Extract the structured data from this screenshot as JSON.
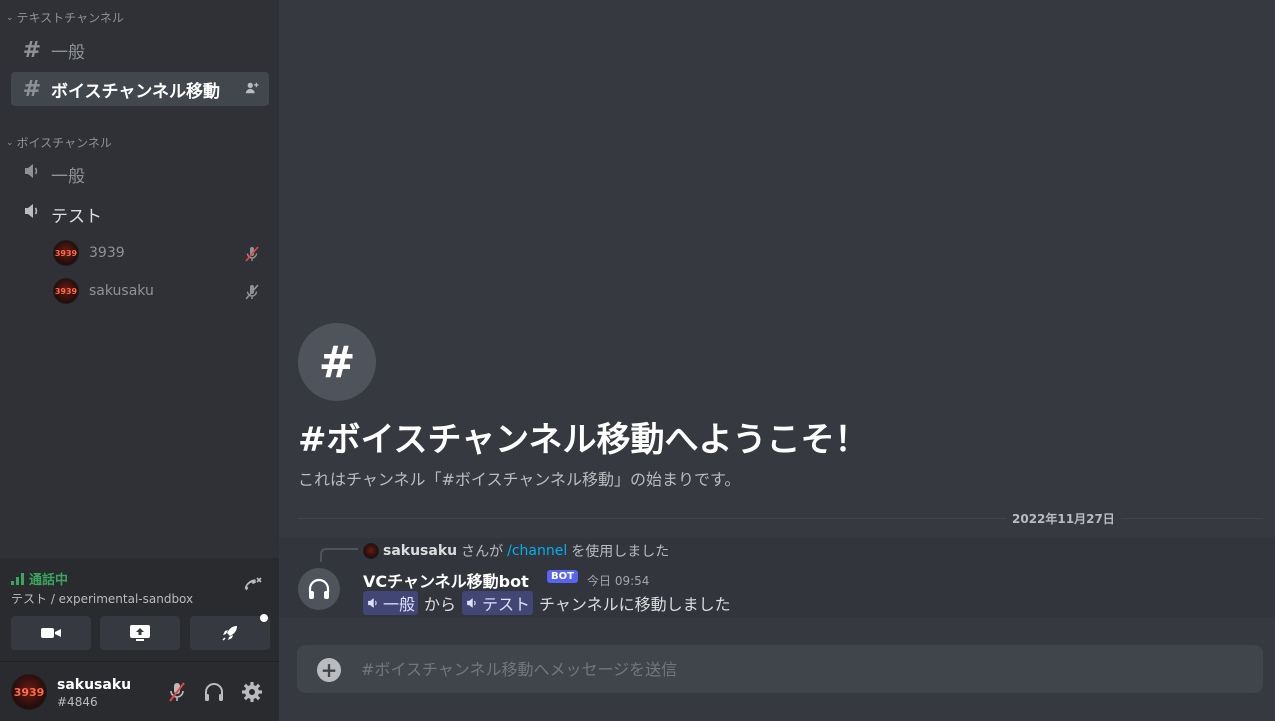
{
  "sidebar": {
    "text_category": "テキストチャンネル",
    "text_channels": [
      {
        "label": "一般"
      },
      {
        "label": "ボイスチャンネル移動"
      }
    ],
    "voice_category": "ボイスチャンネル",
    "voice_channels": [
      {
        "label": "一般"
      },
      {
        "label": "テスト"
      }
    ],
    "voice_users": [
      {
        "name": "3939",
        "avatar_text": "3939"
      },
      {
        "name": "sakusaku",
        "avatar_text": "3939"
      }
    ]
  },
  "voice_panel": {
    "status": "通話中",
    "subtitle": "テスト / experimental-sandbox"
  },
  "user_panel": {
    "username": "sakusaku",
    "tag": "#4846",
    "avatar_text": "3939"
  },
  "welcome": {
    "icon": "#",
    "title": "#ボイスチャンネル移動へようこそ！",
    "description": "これはチャンネル「#ボイスチャンネル移動」の始まりです。"
  },
  "date_divider": "2022年11月27日",
  "message": {
    "reply_user": "sakusaku",
    "reply_mid": "さんが",
    "reply_command": "/channel",
    "reply_end": "を使用しました",
    "author": "VCチャンネル移動bot",
    "bot_tag": "BOT",
    "time": "今日 09:54",
    "from_channel": "一般",
    "text_from": "から",
    "to_channel": "テスト",
    "text_end": "チャンネルに移動しました"
  },
  "composer": {
    "placeholder": "#ボイスチャンネル移動へメッセージを送信"
  },
  "colors": {
    "background": "#36393f",
    "sidebar": "#2f3136",
    "panel": "#292b2f",
    "connected_green": "#3ba55d",
    "blurple": "#5865f2",
    "link": "#00aff4"
  }
}
